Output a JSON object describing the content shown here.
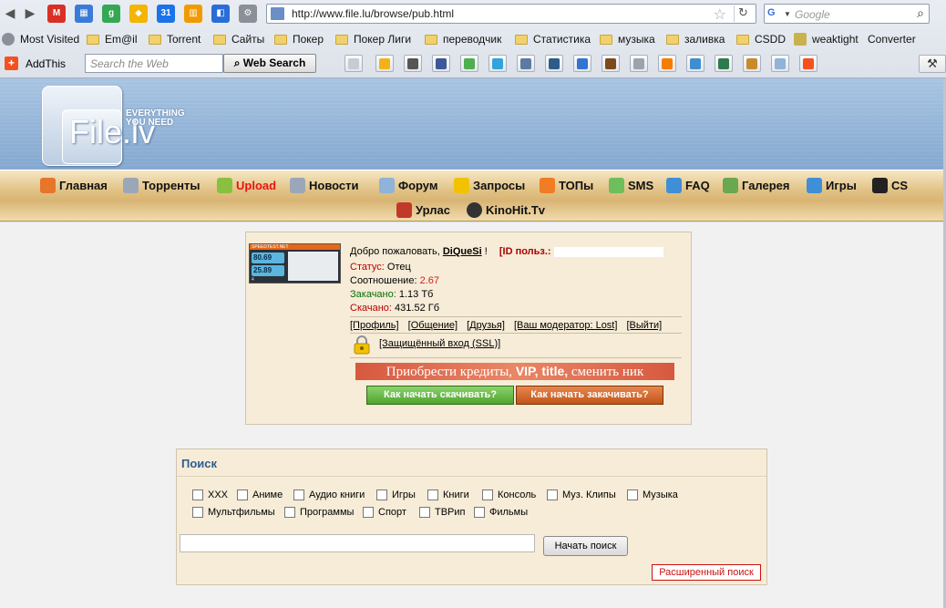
{
  "browser": {
    "url": "http://www.file.lu/browse/pub.html",
    "search_placeholder": "Google",
    "bookmarks": [
      {
        "label": "Most Visited",
        "icon": "gear-icon"
      },
      {
        "label": "Em@il",
        "icon": "folder-icon"
      },
      {
        "label": "Torrent",
        "icon": "folder-icon"
      },
      {
        "label": "Сайты",
        "icon": "folder-icon"
      },
      {
        "label": "Покер",
        "icon": "folder-icon"
      },
      {
        "label": "Покер Лиги",
        "icon": "folder-icon"
      },
      {
        "label": "переводчик",
        "icon": "folder-icon"
      },
      {
        "label": "Статистика",
        "icon": "folder-icon"
      },
      {
        "label": "музыка",
        "icon": "folder-icon"
      },
      {
        "label": "заливка",
        "icon": "folder-icon"
      },
      {
        "label": "CSDD",
        "icon": "folder-icon"
      },
      {
        "label": "weaktight",
        "icon": "trophy-icon"
      },
      {
        "label": "Converter",
        "icon": "page-icon"
      }
    ],
    "addthis_label": "AddThis",
    "web_search_placeholder": "Search the Web",
    "web_search_button": "Web Search"
  },
  "site": {
    "logo_text": "File.lv",
    "logo_tagline": [
      "EVERYTHING",
      "YOU NEED"
    ],
    "nav": [
      {
        "label": "Главная",
        "icon": "home-icon",
        "color": "#e7752a"
      },
      {
        "label": "Торренты",
        "icon": "search-doc-icon",
        "color": "#9aa7b8"
      },
      {
        "label": "Upload",
        "icon": "upload-icon",
        "color": "#8ac03f"
      },
      {
        "label": "Новости",
        "icon": "news-icon",
        "color": "#9aa7b8"
      },
      {
        "label": "Форум",
        "icon": "chat-icon",
        "color": "#8fb3d9"
      },
      {
        "label": "Запросы",
        "icon": "star-icon",
        "color": "#f2c200"
      },
      {
        "label": "ТОПы",
        "icon": "top-icon",
        "color": "#f07c23"
      },
      {
        "label": "SMS",
        "icon": "phone-icon",
        "color": "#6cbf5a"
      },
      {
        "label": "FAQ",
        "icon": "faq-icon",
        "color": "#3f8fd6"
      },
      {
        "label": "Галерея",
        "icon": "gallery-icon",
        "color": "#6aa84f"
      },
      {
        "label": "Игры",
        "icon": "games-icon",
        "color": "#3f8fd6"
      },
      {
        "label": "CS",
        "icon": "cs-icon",
        "color": "#222222"
      },
      {
        "label": "Урлас",
        "icon": "urlas-icon",
        "color": "#c0392b"
      },
      {
        "label": "KinoHit.Tv",
        "icon": "film-reel-icon",
        "color": "#333333"
      }
    ]
  },
  "user": {
    "speedtest": {
      "brand": "SPEEDTEST.NET",
      "download": "80.69",
      "upload": "25.89",
      "ping": "4"
    },
    "welcome": "Добро пожаловать,",
    "username": "DiQueSi",
    "welcome_suffix": "!",
    "id_label": "[ID польз.:",
    "status_label": "Статус:",
    "status_value": "Отец",
    "ratio_label": "Соотношение:",
    "ratio_value": "2.67",
    "uploaded_label": "Закачано:",
    "uploaded_value": "1.13 Тб",
    "downloaded_label": "Скачано:",
    "downloaded_value": "431.52 Гб",
    "links": [
      "[Профиль]",
      "[Общение]",
      "[Друзья]",
      "[Ваш модератор: Lost]",
      "[Выйти]"
    ],
    "ssl_link": "[Защищённый вход (SSL)]",
    "promo_pre": "Приобрести кредиты,",
    "promo_bold": "VIP, title,",
    "promo_post": "сменить ник",
    "how_download": "Как начать скачивать?",
    "how_upload": "Как начать закачивать?"
  },
  "search": {
    "title": "Поиск",
    "categories": [
      "XXX",
      "Аниме",
      "Аудио книги",
      "Игры",
      "Книги",
      "Консоль",
      "Муз. Клипы",
      "Музыка",
      "Мультфильмы",
      "Программы",
      "Спорт",
      "ТВРип",
      "Фильмы"
    ],
    "submit": "Начать поиск",
    "advanced": "Расширенный поиск",
    "value": ""
  },
  "colors": {
    "header_blue": "#8fb0d6",
    "nav_gold": "#d8b473",
    "panel_bg": "#f6ecd7",
    "link_red": "#cc1111",
    "title_blue": "#2d5d93"
  }
}
